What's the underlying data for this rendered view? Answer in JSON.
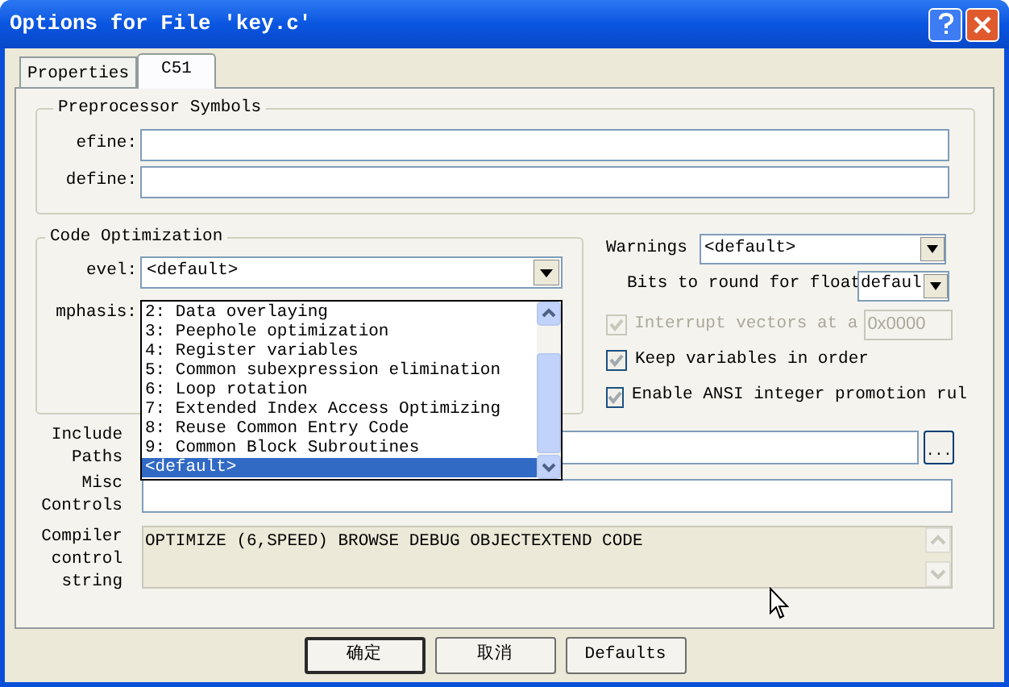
{
  "window": {
    "title": "Options for File 'key.c'"
  },
  "tabs": [
    {
      "label": "Properties",
      "selected": false
    },
    {
      "label": "C51",
      "selected": true
    }
  ],
  "preprocessor_symbols": {
    "title": "Preprocessor Symbols",
    "fields": [
      {
        "label": "efine:"
      },
      {
        "label": "define:"
      }
    ]
  },
  "code_optimization": {
    "title": "Code Optimization",
    "level_label": "evel:",
    "level_value": "<default>",
    "emphasis_label": "mphasis:",
    "dropdown_items": [
      {
        "label": "2: Data overlaying",
        "selected": false
      },
      {
        "label": "3: Peephole optimization",
        "selected": false
      },
      {
        "label": "4: Register variables",
        "selected": false
      },
      {
        "label": "5: Common subexpression elimination",
        "selected": false
      },
      {
        "label": "6: Loop rotation",
        "selected": false
      },
      {
        "label": "7: Extended Index Access Optimizing",
        "selected": false
      },
      {
        "label": "8: Reuse Common Entry Code",
        "selected": false
      },
      {
        "label": "9: Common Block Subroutines",
        "selected": false
      },
      {
        "label": "<default>",
        "selected": true
      }
    ]
  },
  "warnings": {
    "label": "Warnings",
    "value": "<default>"
  },
  "float_bits": {
    "label": "Bits to round for float",
    "value": "defaul"
  },
  "checkboxes": [
    {
      "label": "Interrupt vectors at a",
      "checked": true,
      "disabled": true,
      "value": "0x0000"
    },
    {
      "label": "Keep variables in order",
      "checked": true,
      "disabled": false
    },
    {
      "label": "Enable ANSI integer promotion rul",
      "checked": true,
      "disabled": false
    }
  ],
  "include_paths": {
    "label": "Include Paths",
    "button": "..."
  },
  "misc_controls": {
    "label": "Misc Controls"
  },
  "compiler_control_string": {
    "label": "Compiler control string",
    "value": "OPTIMIZE (6,SPEED) BROWSE DEBUG OBJECTEXTEND CODE"
  },
  "buttons": [
    {
      "label": "确定",
      "default": true
    },
    {
      "label": "取消",
      "default": false
    },
    {
      "label": "Defaults",
      "default": false
    }
  ]
}
